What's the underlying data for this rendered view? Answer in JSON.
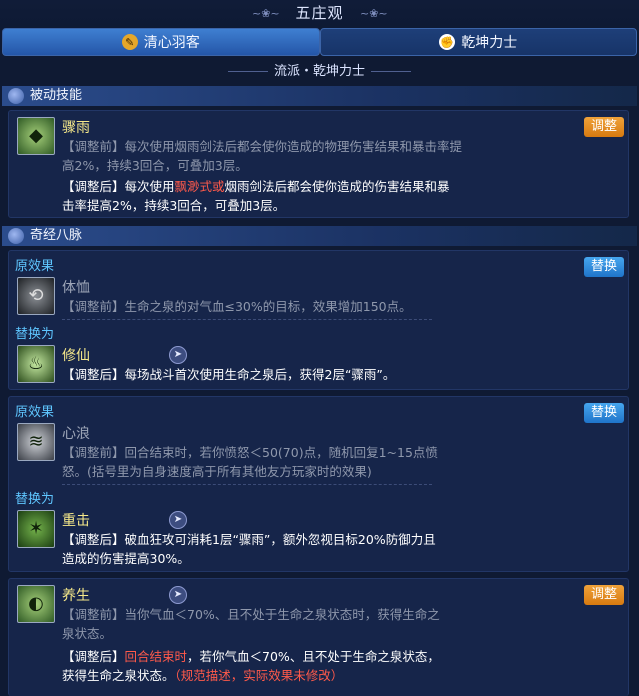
{
  "header": {
    "title": "五庄观"
  },
  "tabs": [
    {
      "label": "清心羽客",
      "icon": "feather-icon"
    },
    {
      "label": "乾坤力士",
      "icon": "fist-icon"
    }
  ],
  "school_label": "流派・乾坤力士",
  "passive": {
    "header": "被动技能",
    "skill": {
      "name": "骤雨",
      "button": "调整",
      "before_text": "【调整前】每次使用烟雨剑法后都会使你造成的物理伤害结果和暴击率提高2%，持续3回合，可叠加3层。",
      "after_prefix": "【调整后】每次使用",
      "after_highlight": "飘渺式或",
      "after_suffix": "烟雨剑法后都会使你造成的伤害结果和暴击率提高2%，持续3回合，可叠加3层。"
    }
  },
  "meridian": {
    "header": "奇经八脉",
    "orig_label": "原效果",
    "replace_label": "替换为",
    "replace_button": "替换",
    "adjust_button": "调整",
    "items": [
      {
        "orig_name": "体恤",
        "orig_text": "【调整前】生命之泉的对气血≤30%的目标，效果增加150点。",
        "new_name": "修仙",
        "new_text": "【调整后】每场战斗首次使用生命之泉后，获得2层“骤雨”。"
      },
      {
        "orig_name": "心浪",
        "orig_text": "【调整前】回合结束时，若你愤怒＜50(70)点，随机回复1~15点愤怒。(括号里为自身速度高于所有其他友方玩家时的效果)",
        "new_name": "重击",
        "new_text": "【调整后】破血狂攻可消耗1层“骤雨”，额外忽视目标20%防御力且造成的伤害提高30%。"
      }
    ],
    "last": {
      "name": "养生",
      "before_text": "【调整前】当你气血＜70%、且不处于生命之泉状态时，获得生命之泉状态。",
      "after_prefix": "【调整后】",
      "after_highlight": "回合结束时",
      "after_suffix": "，若你气血＜70%、且不处于生命之泉状态，获得生命之泉状态。",
      "note": "（规范描述，实际效果未修改）"
    }
  }
}
